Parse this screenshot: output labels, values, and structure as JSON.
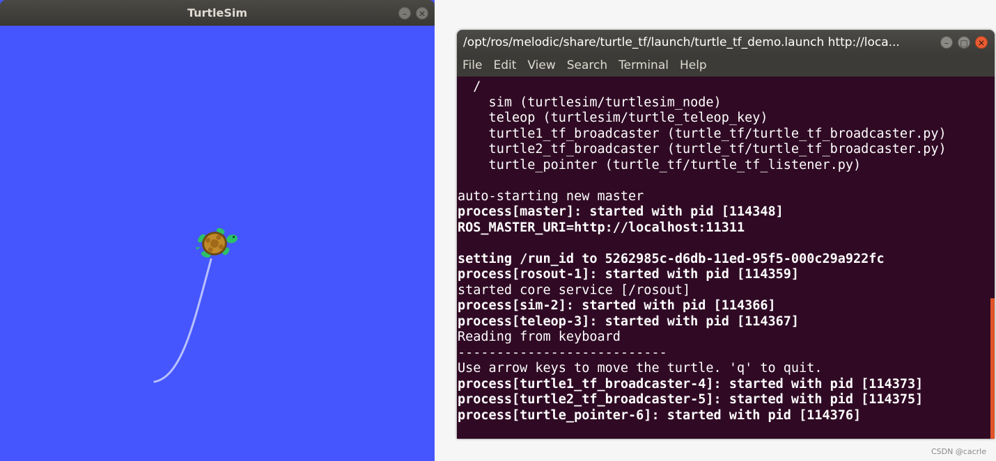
{
  "turtlesim": {
    "title": "TurtleSim",
    "min_glyph": "–",
    "close_glyph": "✕",
    "background_color": "#4556fe",
    "trail_color": "#b8c0ff",
    "turtle_icon": "turtle-icon"
  },
  "terminal": {
    "title": "/opt/ros/melodic/share/turtle_tf/launch/turtle_tf_demo.launch http://loca...",
    "min_glyph": "–",
    "max_glyph": "□",
    "close_glyph": "✕",
    "menu": [
      "File",
      "Edit",
      "View",
      "Search",
      "Terminal",
      "Help"
    ],
    "background_color": "#300a24",
    "lines": [
      {
        "text": "  /",
        "bold": false
      },
      {
        "text": "    sim (turtlesim/turtlesim_node)",
        "bold": false
      },
      {
        "text": "    teleop (turtlesim/turtle_teleop_key)",
        "bold": false
      },
      {
        "text": "    turtle1_tf_broadcaster (turtle_tf/turtle_tf_broadcaster.py)",
        "bold": false
      },
      {
        "text": "    turtle2_tf_broadcaster (turtle_tf/turtle_tf_broadcaster.py)",
        "bold": false
      },
      {
        "text": "    turtle_pointer (turtle_tf/turtle_tf_listener.py)",
        "bold": false
      },
      {
        "text": "",
        "bold": false
      },
      {
        "text": "auto-starting new master",
        "bold": false
      },
      {
        "text": "process[master]: started with pid [114348]",
        "bold": true
      },
      {
        "text": "ROS_MASTER_URI=http://localhost:11311",
        "bold": true
      },
      {
        "text": "",
        "bold": false
      },
      {
        "text": "setting /run_id to 5262985c-d6db-11ed-95f5-000c29a922fc",
        "bold": true
      },
      {
        "text": "process[rosout-1]: started with pid [114359]",
        "bold": true
      },
      {
        "text": "started core service [/rosout]",
        "bold": false
      },
      {
        "text": "process[sim-2]: started with pid [114366]",
        "bold": true
      },
      {
        "text": "process[teleop-3]: started with pid [114367]",
        "bold": true
      },
      {
        "text": "Reading from keyboard",
        "bold": false
      },
      {
        "text": "---------------------------",
        "bold": false
      },
      {
        "text": "Use arrow keys to move the turtle. 'q' to quit.",
        "bold": false
      },
      {
        "text": "process[turtle1_tf_broadcaster-4]: started with pid [114373]",
        "bold": true
      },
      {
        "text": "process[turtle2_tf_broadcaster-5]: started with pid [114375]",
        "bold": true
      },
      {
        "text": "process[turtle_pointer-6]: started with pid [114376]",
        "bold": true
      }
    ]
  },
  "watermark": "CSDN @cacrle"
}
